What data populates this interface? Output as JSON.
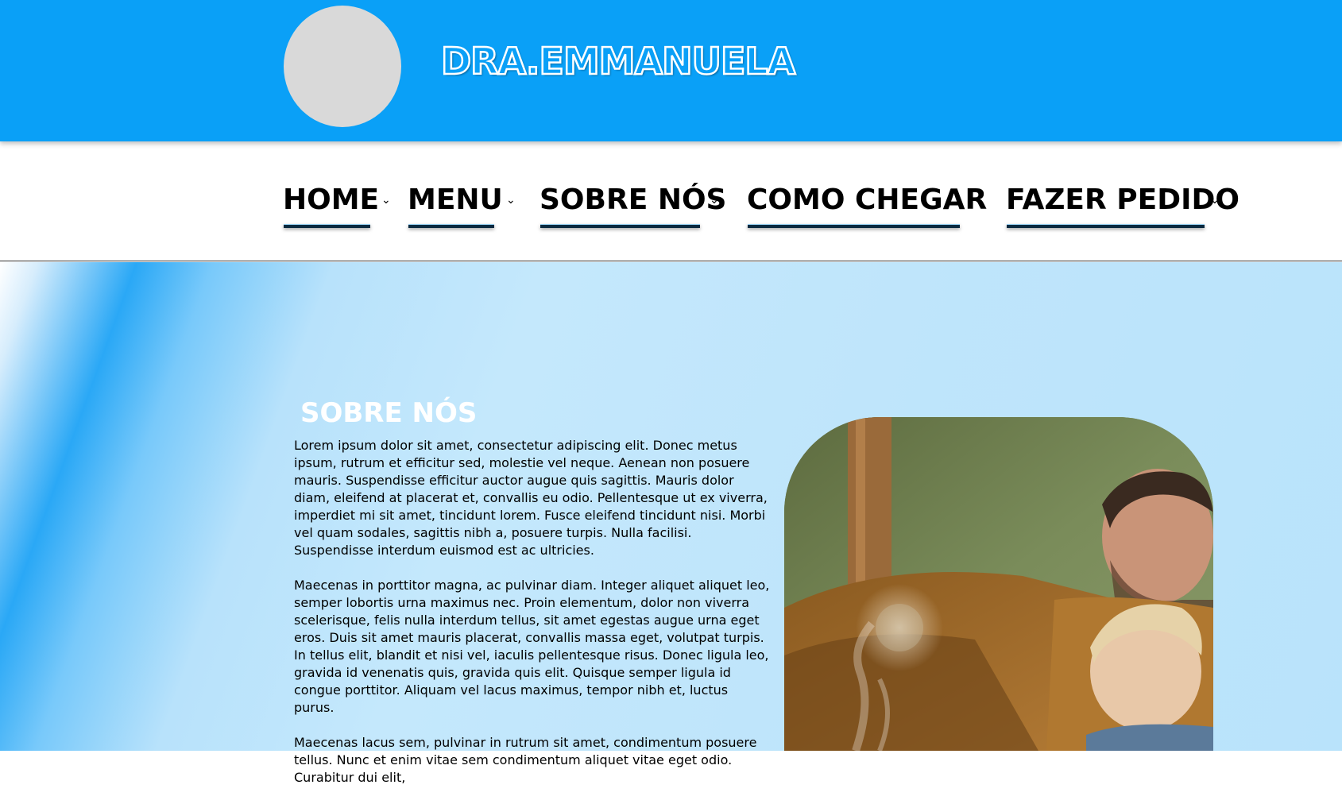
{
  "header": {
    "logo_icon": "logo-placeholder-circle",
    "site_title": "DRA.EMMANUELA"
  },
  "nav": {
    "items": [
      {
        "label": "HOME",
        "has_dropdown": true
      },
      {
        "label": "MENU",
        "has_dropdown": true
      },
      {
        "label": "SOBRE NÓS",
        "has_dropdown": true
      },
      {
        "label": "COMO CHEGAR",
        "has_dropdown": false
      },
      {
        "label": "FAZER PEDIDO",
        "has_dropdown": true
      }
    ],
    "dropdown_icon": "chevron-down-icon"
  },
  "about": {
    "heading": "SOBRE NÓS",
    "paragraphs": [
      "Lorem ipsum dolor sit amet, consectetur adipiscing elit. Donec metus ipsum, rutrum et efficitur sed, molestie vel neque. Aenean non posuere mauris. Suspendisse efficitur auctor augue quis sagittis. Mauris dolor diam, eleifend at placerat et, convallis eu odio. Pellentesque ut ex viverra, imperdiet mi sit amet, tincidunt lorem. Fusce eleifend tincidunt nisi. Morbi vel quam sodales, sagittis nibh a, posuere turpis. Nulla facilisi. Suspendisse interdum euismod est ac ultricies.",
      "Maecenas in porttitor magna, ac pulvinar diam. Integer aliquet aliquet leo, semper lobortis urna maximus nec. Proin elementum, dolor non viverra scelerisque, felis nulla interdum tellus, sit amet egestas augue urna eget eros. Duis sit amet mauris placerat, convallis massa eget, volutpat turpis. In tellus elit, blandit et nisi vel, iaculis pellentesque risus. Donec ligula leo, gravida id venenatis quis, gravida quis elit. Quisque semper ligula id congue porttitor. Aliquam vel lacus maximus, tempor nibh et, luctus purus.",
      "Maecenas lacus sem, pulvinar in rutrum sit amet, condimentum posuere tellus. Nunc et enim vitae sem condimentum aliquet vitae eget odio. Curabitur dui elit,"
    ],
    "photo": "father-and-baby-photo"
  },
  "colors": {
    "header_blue": "#0aa0f7",
    "nav_underline": "#0b2a40",
    "hero_light_blue": "#bfe5fb",
    "logo_placeholder": "#d9d9d9"
  }
}
